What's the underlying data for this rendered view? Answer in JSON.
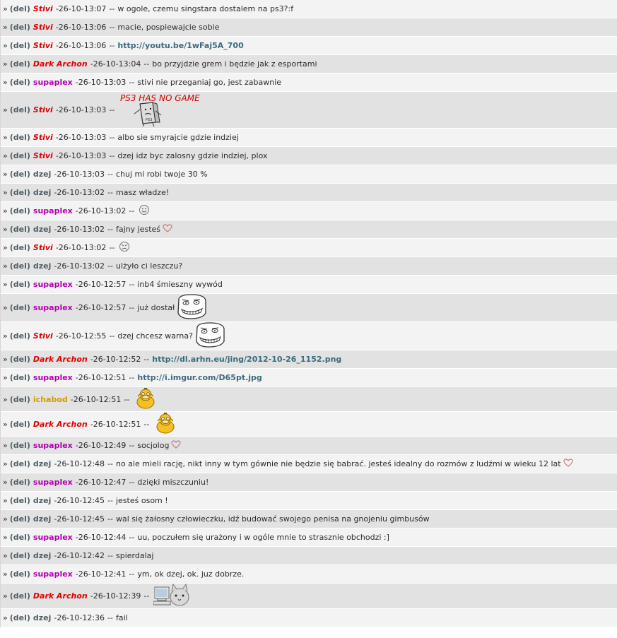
{
  "ui": {
    "raquo": "»",
    "del_label": "(del)",
    "dash": "-",
    "separator": "--"
  },
  "colors": {
    "Stivi": "#e00000",
    "Dark Archon": "#e00000",
    "supaplex": "#b300b3",
    "dzej": "#4d5f66",
    "ichabod": "#d49a00",
    "link": "#3a6a7d"
  },
  "messages": [
    {
      "nick": "Stivi",
      "admin": true,
      "time": "26-10-13:07",
      "text": "w ogole, czemu singstara dostalem na ps3?:f"
    },
    {
      "nick": "Stivi",
      "admin": true,
      "time": "26-10-13:06",
      "text": "macie, pospiewajcie sobie"
    },
    {
      "nick": "Stivi",
      "admin": true,
      "time": "26-10-13:06",
      "text": "http://youtu.be/1wFaj5A_700",
      "link": true
    },
    {
      "nick": "Dark Archon",
      "admin": true,
      "time": "26-10-13:04",
      "text": "bo przyjdzie grem i będzie jak z esportami"
    },
    {
      "nick": "supaplex",
      "admin": false,
      "time": "26-10-13:03",
      "text": "stivi nie przeganiaj go, jest zabawnie"
    },
    {
      "nick": "Stivi",
      "admin": true,
      "time": "26-10-13:03",
      "text": "",
      "image": "ps3-meme",
      "image_caption": "PS3 HAS NO GAME"
    },
    {
      "nick": "Stivi",
      "admin": true,
      "time": "26-10-13:03",
      "text": "albo sie smyrajcie gdzie indziej"
    },
    {
      "nick": "Stivi",
      "admin": true,
      "time": "26-10-13:03",
      "text": "dzej idz byc zalosny gdzie indziej, plox"
    },
    {
      "nick": "dzej",
      "admin": false,
      "time": "26-10-13:03",
      "text": "chuj mi robi twoje 30 %"
    },
    {
      "nick": "dzej",
      "admin": false,
      "time": "26-10-13:02",
      "text": "masz władze!"
    },
    {
      "nick": "supaplex",
      "admin": false,
      "time": "26-10-13:02",
      "text": "",
      "image": "smile-emoticon"
    },
    {
      "nick": "dzej",
      "admin": false,
      "time": "26-10-13:02",
      "text": "fajny jesteś",
      "heart": true
    },
    {
      "nick": "Stivi",
      "admin": true,
      "time": "26-10-13:02",
      "text": "",
      "image": "angry-emoticon"
    },
    {
      "nick": "dzej",
      "admin": false,
      "time": "26-10-13:02",
      "text": "ulżyło ci leszczu?"
    },
    {
      "nick": "supaplex",
      "admin": false,
      "time": "26-10-12:57",
      "text": "inb4 śmieszny wywód"
    },
    {
      "nick": "supaplex",
      "admin": false,
      "time": "26-10-12:57",
      "text": "już dostał",
      "image": "troll-face"
    },
    {
      "nick": "Stivi",
      "admin": true,
      "time": "26-10-12:55",
      "text": "dzej chcesz warna?",
      "image": "troll-face"
    },
    {
      "nick": "Dark Archon",
      "admin": true,
      "time": "26-10-12:52",
      "text": "http://dl.arhn.eu/jing/2012-10-26_1152.png",
      "link": true
    },
    {
      "nick": "supaplex",
      "admin": false,
      "time": "26-10-12:51",
      "text": "http://i.imgur.com/D65pt.jpg",
      "link": true
    },
    {
      "nick": "ichabod",
      "admin": false,
      "time": "26-10-12:51",
      "text": "",
      "image": "psyduck"
    },
    {
      "nick": "Dark Archon",
      "admin": true,
      "time": "26-10-12:51",
      "text": "",
      "image": "psyduck"
    },
    {
      "nick": "supaplex",
      "admin": false,
      "time": "26-10-12:49",
      "text": "socjolog",
      "heart": true
    },
    {
      "nick": "dzej",
      "admin": false,
      "time": "26-10-12:48",
      "text": "no ale mieli rację, nikt inny w tym gównie nie będzie się babrać. jesteś idealny do rozmów z ludźmi w wieku 12 lat",
      "heart": true
    },
    {
      "nick": "supaplex",
      "admin": false,
      "time": "26-10-12:47",
      "text": "dzięki miszczuniu!"
    },
    {
      "nick": "dzej",
      "admin": false,
      "time": "26-10-12:45",
      "text": "jesteś osom !"
    },
    {
      "nick": "dzej",
      "admin": false,
      "time": "26-10-12:45",
      "text": "wal się żałosny człowieczku, idź budować swojego penisa na gnojeniu gimbusów"
    },
    {
      "nick": "supaplex",
      "admin": false,
      "time": "26-10-12:44",
      "text": "uu, poczułem się urażony i w ogóle mnie to strasznie obchodzi :]"
    },
    {
      "nick": "dzej",
      "admin": false,
      "time": "26-10-12:42",
      "text": "spierdalaj"
    },
    {
      "nick": "supaplex",
      "admin": false,
      "time": "26-10-12:41",
      "text": "ym, ok dzej, ok. juz dobrze."
    },
    {
      "nick": "Dark Archon",
      "admin": true,
      "time": "26-10-12:39",
      "text": "",
      "image": "cat-computer"
    },
    {
      "nick": "dzej",
      "admin": false,
      "time": "26-10-12:36",
      "text": "fail"
    }
  ]
}
